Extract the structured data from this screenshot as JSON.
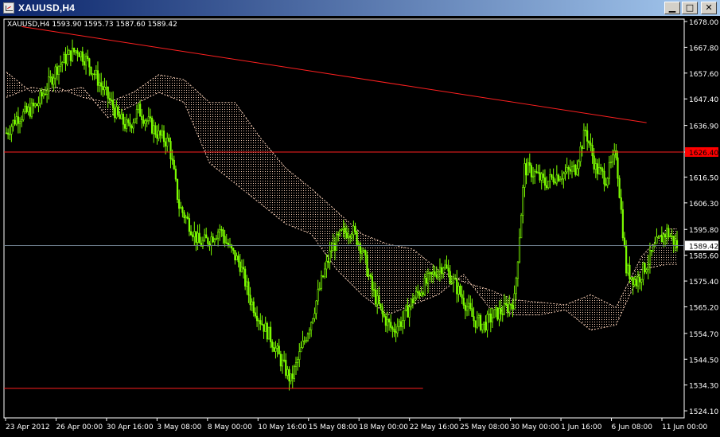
{
  "window": {
    "title": "XAUUSD,H4",
    "buttons": {
      "minimize": "▁",
      "maximize": "□",
      "close": "✕"
    }
  },
  "symbol_info": "XAUUSD,H4  1593.90 1595.73 1587.60 1589.42",
  "colors": {
    "background": "#000000",
    "bull_candle": "#7cfc00",
    "cloud": "#f0c8b0",
    "trendline": "#ff2020",
    "price_line": "#708090",
    "axis_text": "#ffffff",
    "price_label_bg": "#ff0000"
  },
  "chart_data": {
    "type": "candlestick",
    "symbol": "XAUUSD",
    "timeframe": "H4",
    "last_quote": {
      "open": 1593.9,
      "high": 1595.73,
      "low": 1587.6,
      "close": 1589.42
    },
    "y_ticks": [
      "1678.00",
      "1667.80",
      "1657.60",
      "1647.40",
      "1636.90",
      "1626.40",
      "1616.50",
      "1606.30",
      "1595.80",
      "1585.60",
      "1575.40",
      "1565.20",
      "1554.70",
      "1544.50",
      "1534.30",
      "1524.10"
    ],
    "ylim": [
      1521.3,
      1678.0
    ],
    "x_ticks": [
      "23 Apr 2012",
      "26 Apr 00:00",
      "30 Apr 16:00",
      "3 May 08:00",
      "8 May 00:00",
      "10 May 16:00",
      "15 May 08:00",
      "18 May 00:00",
      "22 May 16:00",
      "25 May 08:00",
      "30 May 00:00",
      "1 Jun 16:00",
      "6 Jun 08:00",
      "11 Jun 00:00"
    ],
    "close_path": [
      [
        0,
        1634
      ],
      [
        2,
        1640
      ],
      [
        4,
        1642
      ],
      [
        6,
        1645
      ],
      [
        8,
        1652
      ],
      [
        10,
        1660
      ],
      [
        12,
        1664
      ],
      [
        14,
        1667
      ],
      [
        16,
        1662
      ],
      [
        18,
        1655
      ],
      [
        20,
        1648
      ],
      [
        22,
        1640
      ],
      [
        24,
        1636
      ],
      [
        26,
        1643
      ],
      [
        28,
        1638
      ],
      [
        30,
        1633
      ],
      [
        32,
        1630
      ],
      [
        34,
        1605
      ],
      [
        36,
        1598
      ],
      [
        38,
        1590
      ],
      [
        40,
        1592
      ],
      [
        42,
        1596
      ],
      [
        44,
        1588
      ],
      [
        46,
        1582
      ],
      [
        48,
        1568
      ],
      [
        50,
        1560
      ],
      [
        52,
        1553
      ],
      [
        54,
        1544
      ],
      [
        56,
        1536
      ],
      [
        58,
        1548
      ],
      [
        60,
        1560
      ],
      [
        62,
        1575
      ],
      [
        64,
        1588
      ],
      [
        66,
        1594
      ],
      [
        68,
        1596
      ],
      [
        70,
        1588
      ],
      [
        72,
        1572
      ],
      [
        74,
        1562
      ],
      [
        76,
        1556
      ],
      [
        78,
        1560
      ],
      [
        80,
        1568
      ],
      [
        82,
        1573
      ],
      [
        84,
        1578
      ],
      [
        86,
        1582
      ],
      [
        88,
        1575
      ],
      [
        90,
        1568
      ],
      [
        92,
        1560
      ],
      [
        94,
        1558
      ],
      [
        96,
        1562
      ],
      [
        98,
        1564
      ],
      [
        100,
        1568
      ],
      [
        102,
        1620
      ],
      [
        104,
        1618
      ],
      [
        106,
        1614
      ],
      [
        108,
        1617
      ],
      [
        110,
        1618
      ],
      [
        112,
        1620
      ],
      [
        114,
        1635
      ],
      [
        116,
        1620
      ],
      [
        118,
        1616
      ],
      [
        120,
        1626
      ],
      [
        122,
        1580
      ],
      [
        124,
        1575
      ],
      [
        126,
        1582
      ],
      [
        128,
        1590
      ],
      [
        130,
        1595
      ],
      [
        132,
        1589.42
      ]
    ],
    "cloud_path_a": [
      [
        0,
        1658
      ],
      [
        5,
        1650
      ],
      [
        10,
        1652
      ],
      [
        15,
        1648
      ],
      [
        20,
        1646
      ],
      [
        25,
        1650
      ],
      [
        30,
        1657
      ],
      [
        35,
        1655
      ],
      [
        40,
        1646
      ],
      [
        45,
        1646
      ],
      [
        50,
        1632
      ],
      [
        55,
        1620
      ],
      [
        60,
        1612
      ],
      [
        65,
        1603
      ],
      [
        70,
        1594
      ],
      [
        75,
        1590
      ],
      [
        80,
        1588
      ],
      [
        85,
        1580
      ],
      [
        90,
        1575
      ],
      [
        95,
        1572
      ],
      [
        100,
        1568
      ],
      [
        105,
        1567
      ],
      [
        110,
        1566
      ],
      [
        115,
        1570
      ],
      [
        120,
        1565
      ],
      [
        125,
        1585
      ],
      [
        130,
        1596
      ],
      [
        132,
        1596
      ]
    ],
    "cloud_path_b": [
      [
        0,
        1648
      ],
      [
        5,
        1652
      ],
      [
        10,
        1650
      ],
      [
        15,
        1652
      ],
      [
        20,
        1640
      ],
      [
        25,
        1645
      ],
      [
        30,
        1650
      ],
      [
        35,
        1646
      ],
      [
        40,
        1622
      ],
      [
        45,
        1614
      ],
      [
        50,
        1606
      ],
      [
        55,
        1598
      ],
      [
        60,
        1594
      ],
      [
        65,
        1580
      ],
      [
        70,
        1570
      ],
      [
        75,
        1562
      ],
      [
        80,
        1566
      ],
      [
        85,
        1570
      ],
      [
        90,
        1578
      ],
      [
        95,
        1565
      ],
      [
        100,
        1562
      ],
      [
        105,
        1562
      ],
      [
        110,
        1564
      ],
      [
        115,
        1556
      ],
      [
        120,
        1558
      ],
      [
        125,
        1580
      ],
      [
        130,
        1582
      ],
      [
        132,
        1582
      ]
    ],
    "trendline": {
      "start": [
        3,
        1676
      ],
      "end": [
        126,
        1638
      ]
    },
    "horizontal_levels": [
      {
        "price": 1626.4,
        "label": "1626.40",
        "style": "resistance"
      },
      {
        "price": 1533.0,
        "label": "",
        "style": "support"
      }
    ],
    "current_price": {
      "price": 1589.42,
      "label": "1589.42"
    }
  }
}
